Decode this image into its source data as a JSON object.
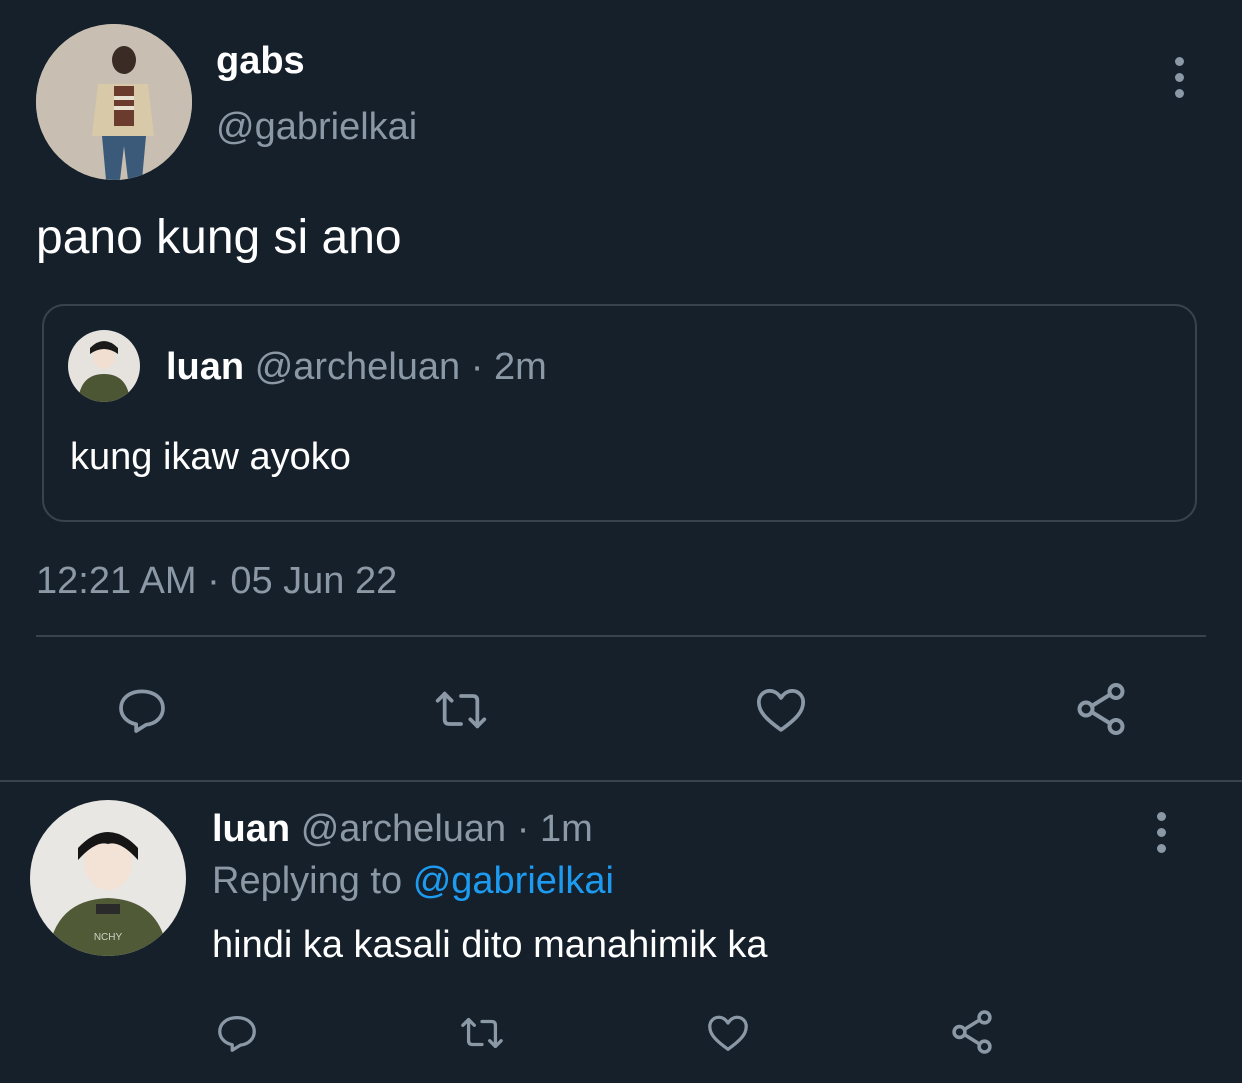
{
  "tweet": {
    "author_name": "gabs",
    "author_handle": "@gabrielkai",
    "text": "pano kung si ano",
    "timestamp": "12:21 AM · 05 Jun 22",
    "quoted": {
      "author_name": "luan",
      "author_handle": "@archeluan",
      "separator": "·",
      "time_ago": "2m",
      "text": "kung ikaw ayoko"
    }
  },
  "reply": {
    "author_name": "luan",
    "author_handle": "@archeluan",
    "separator": "·",
    "time_ago": "1m",
    "replying_to_label": "Replying to",
    "replying_to_handle": "@gabrielkai",
    "text": "hindi ka kasali dito manahimik ka"
  },
  "actions": [
    "reply-icon",
    "retweet-icon",
    "like-icon",
    "share-icon"
  ],
  "colors": {
    "background": "#15202b",
    "text": "#ffffff",
    "muted": "#8b98a5",
    "border": "#38444d",
    "link": "#1d9bf0"
  }
}
